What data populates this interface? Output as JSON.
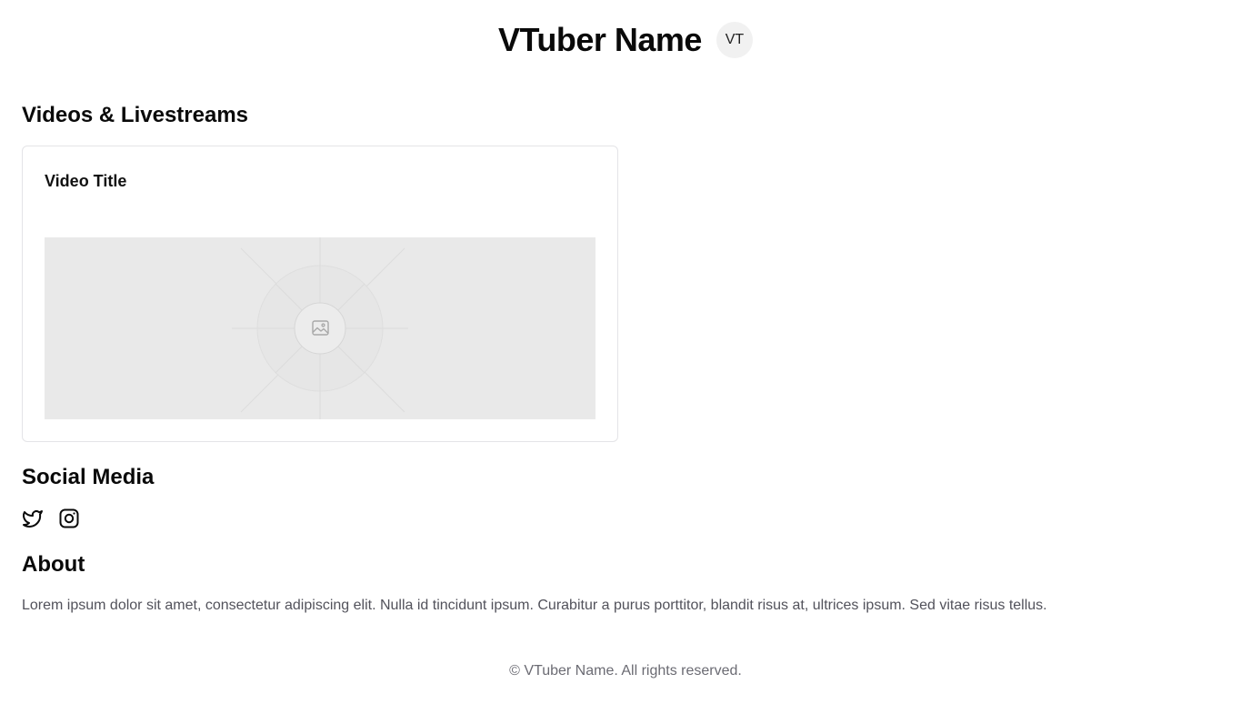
{
  "header": {
    "title": "VTuber Name",
    "avatar_initials": "VT"
  },
  "videos": {
    "heading": "Videos & Livestreams",
    "items": [
      {
        "title": "Video Title",
        "thumbnail_icon": "image-placeholder-icon"
      }
    ]
  },
  "social": {
    "heading": "Social Media",
    "icons": [
      "twitter-icon",
      "instagram-icon"
    ]
  },
  "about": {
    "heading": "About",
    "text": "Lorem ipsum dolor sit amet, consectetur adipiscing elit. Nulla id tincidunt ipsum. Curabitur a purus porttitor, blandit risus at, ultrices ipsum. Sed vitae risus tellus."
  },
  "footer": {
    "text": "© VTuber Name. All rights reserved."
  },
  "colors": {
    "text": "#0a0a0a",
    "muted": "#52525b",
    "border": "#e4e4e7",
    "placeholder_bg": "#e9e9e9"
  }
}
